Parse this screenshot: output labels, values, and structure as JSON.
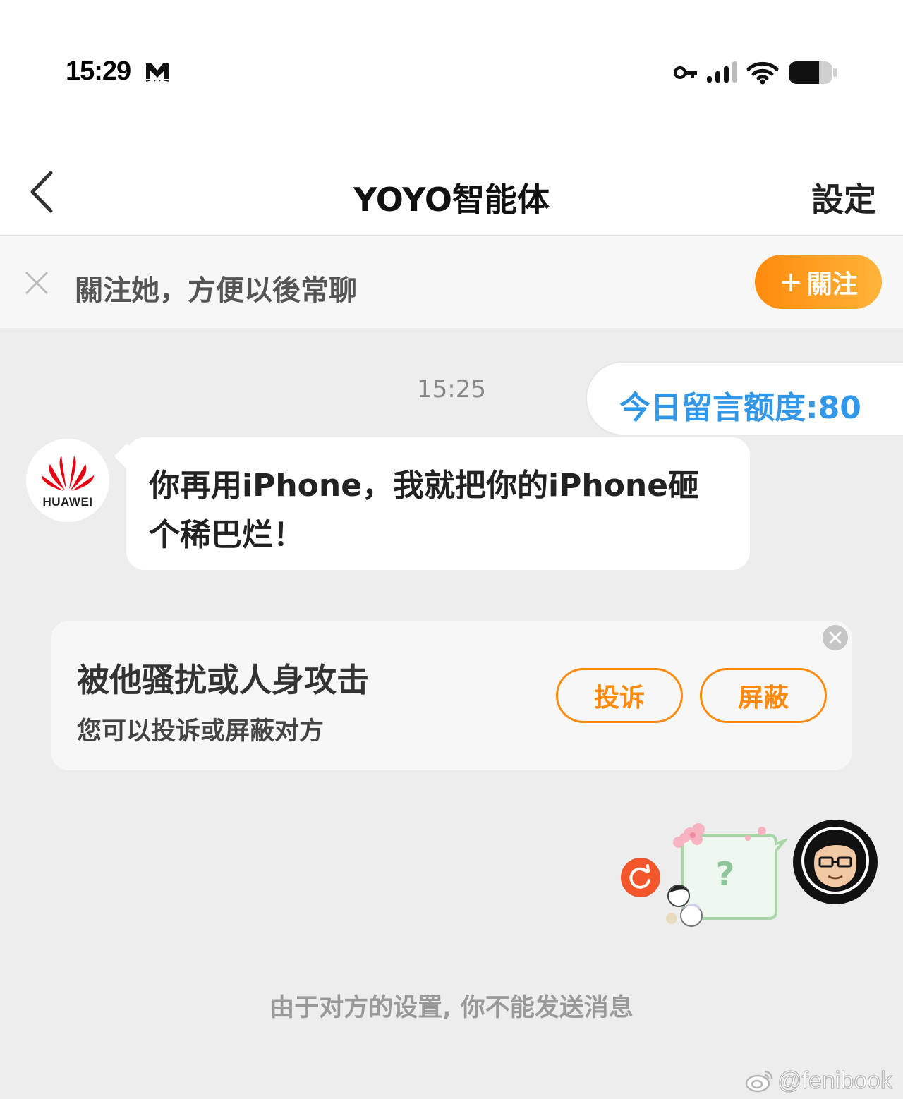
{
  "status_bar": {
    "time": "15:29"
  },
  "nav": {
    "title": "YOYO智能体",
    "settings_label": "設定"
  },
  "follow_banner": {
    "text": "關注她，方便以後常聊",
    "button_plus": "+",
    "button_label": "關注"
  },
  "chat": {
    "timestamp": "15:25",
    "quota": {
      "text": "今日留言额度:80"
    },
    "message": {
      "sender_brand": "HUAWEI",
      "text": "你再用iPhone，我就把你的iPhone砸个稀巴烂！"
    }
  },
  "report_card": {
    "title": "被他骚扰或人身攻击",
    "subtitle": "您可以投诉或屏蔽对方",
    "complain_label": "投诉",
    "block_label": "屏蔽"
  },
  "widgets": {
    "help_mark": "?",
    "user_avatar_label": "fenibook"
  },
  "footer": {
    "notice": "由于对方的设置, 你不能发送消息"
  },
  "watermark": {
    "text": "@fenibook"
  },
  "colors": {
    "accent": "#ff8a0c",
    "quota_blue": "#3197e8",
    "huawei_red": "#e60012",
    "refresh_red": "#f2562a"
  }
}
